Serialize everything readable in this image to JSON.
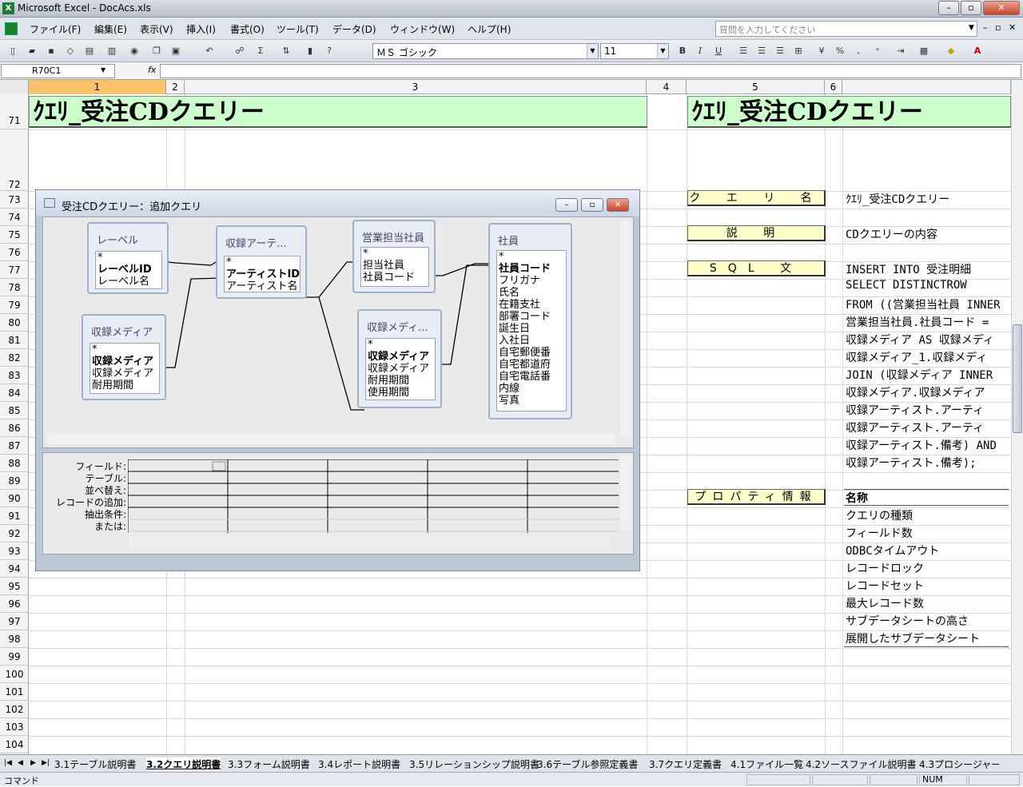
{
  "window": {
    "title": "Microsoft Excel - DocAcs.xls",
    "app_icon": "excel-icon"
  },
  "menu": {
    "items": [
      "ファイル(F)",
      "編集(E)",
      "表示(V)",
      "挿入(I)",
      "書式(O)",
      "ツール(T)",
      "データ(D)",
      "ウィンドウ(W)",
      "ヘルプ(H)"
    ],
    "help_placeholder": "質問を入力してください"
  },
  "toolbar": {
    "font_name": "ＭＳ ゴシック",
    "font_size": "11"
  },
  "formula": {
    "name_box": "R70C1",
    "fx": "fx"
  },
  "columns": [
    "1",
    "2",
    "3",
    "4",
    "5",
    "6"
  ],
  "rows": [
    "71",
    "72",
    "73",
    "74",
    "75",
    "76",
    "77",
    "78",
    "79",
    "80",
    "81",
    "82",
    "83",
    "84",
    "85",
    "86",
    "87",
    "88",
    "89",
    "90",
    "91",
    "92",
    "93",
    "94",
    "95",
    "96",
    "97",
    "98",
    "99",
    "100",
    "101",
    "102",
    "103",
    "104"
  ],
  "sheet": {
    "title_left": "ｸｴﾘ_受注CDクエリー",
    "title_right": "ｸｴﾘ_受注CDクエリー",
    "labels": {
      "query_name": "ク エ リ 名",
      "description": "説 明",
      "sql": "SQL 文",
      "properties": "プロパティ情報"
    },
    "query_name_value": "ｸｴﾘ_受注CDクエリー",
    "description_value": "CDクエリーの内容",
    "sql_lines": [
      "INSERT INTO 受注明細",
      "SELECT DISTINCTROW",
      "FROM ((営業担当社員 INNER",
      "営業担当社員.社員コード =",
      "収録メディア AS 収録メディ",
      "収録メディア_1.収録メディ",
      "JOIN (収録メディア INNER",
      "収録メディア.収録メディア",
      "収録アーティスト.アーティ",
      "収録アーティスト.アーティ",
      "収録アーティスト.備考) AND",
      "収録アーティスト.備考);"
    ],
    "property_header": "名称",
    "property_items": [
      "クエリの種類",
      "フィールド数",
      "ODBCタイムアウト",
      "レコードロック",
      "レコードセット",
      "最大レコード数",
      "サブデータシートの高さ",
      "展開したサブデータシート"
    ]
  },
  "query_window": {
    "title": "受注CDクエリー：追加クエリ",
    "tables": [
      {
        "name": "レーベル",
        "fields": [
          "*",
          "レーベルID",
          "レーベル名"
        ]
      },
      {
        "name": "収録アーテ...",
        "fields": [
          "*",
          "アーティストID",
          "アーティスト名"
        ]
      },
      {
        "name": "営業担当社員",
        "fields": [
          "*",
          "担当社員",
          "社員コード"
        ]
      },
      {
        "name": "社員",
        "fields": [
          "*",
          "社員コード",
          "フリガナ",
          "氏名",
          "在籍支社",
          "部署コード",
          "誕生日",
          "入社日",
          "自宅郵便番",
          "自宅都道府",
          "自宅電話番",
          "内線",
          "写真"
        ]
      },
      {
        "name": "収録メディア",
        "fields": [
          "*",
          "収録メディア",
          "収録メディア",
          "耐用期間"
        ]
      },
      {
        "name": "収録メディ...",
        "fields": [
          "*",
          "収録メディア",
          "収録メディア",
          "耐用期間",
          "使用期間"
        ]
      }
    ],
    "grid_rows": [
      "フィールド:",
      "テーブル:",
      "並べ替え:",
      "レコードの追加:",
      "抽出条件:",
      "または:"
    ]
  },
  "tabs": [
    "3.1テーブル説明書",
    "3.2クエリ説明書",
    "3.3フォーム説明書",
    "3.4レポート説明書",
    "3.5リレーションシップ説明書",
    "3.6テーブル参照定義書",
    "3.7クエリ定義書",
    "4.1ファイル一覧",
    "4.2ソースファイル説明書",
    "4.3プロシージャー"
  ],
  "status": {
    "mode": "コマンド",
    "num": "NUM"
  }
}
